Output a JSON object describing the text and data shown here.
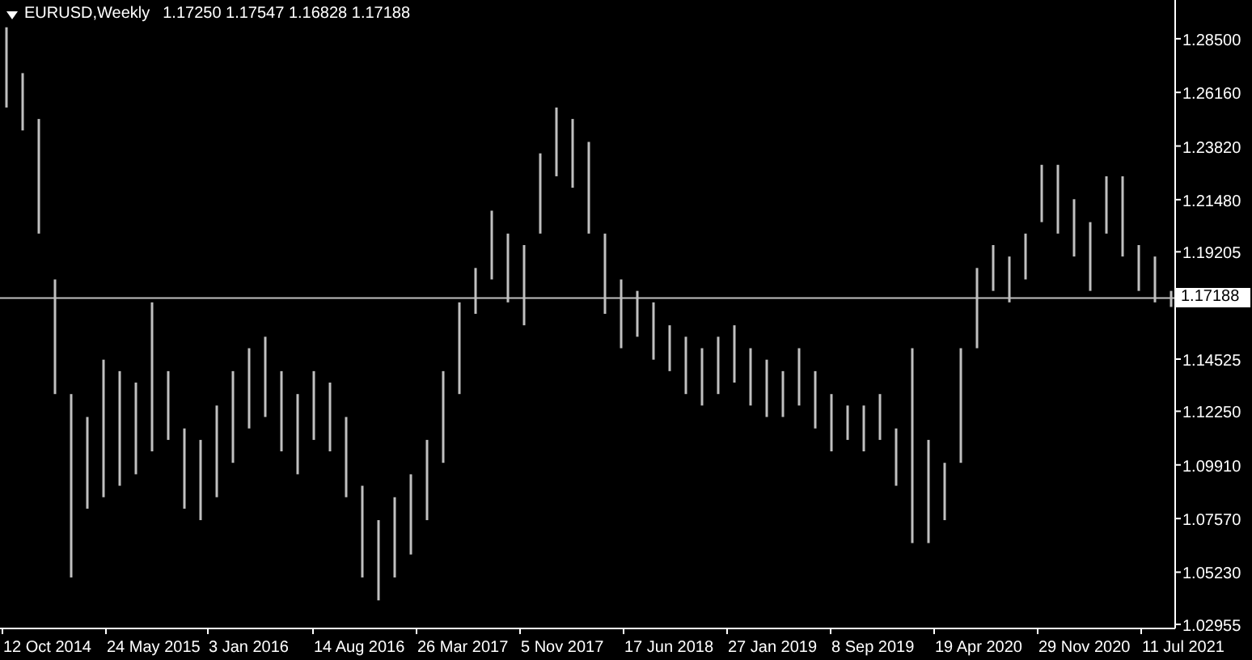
{
  "header": {
    "symbol_timeframe": "EURUSD,Weekly",
    "ohlc": "1.17250 1.17547 1.16828 1.17188"
  },
  "price_axis": {
    "labels": [
      "1.28500",
      "1.26160",
      "1.23820",
      "1.21480",
      "1.19205",
      "1.14525",
      "1.12250",
      "1.09910",
      "1.07570",
      "1.05230",
      "1.02955"
    ]
  },
  "time_axis": {
    "labels": [
      "12 Oct 2014",
      "24 May 2015",
      "3 Jan 2016",
      "14 Aug 2016",
      "26 Mar 2017",
      "5 Nov 2017",
      "17 Jun 2018",
      "27 Jan 2019",
      "8 Sep 2019",
      "19 Apr 2020",
      "29 Nov 2020",
      "11 Jul 2021"
    ]
  },
  "current_price": {
    "label": "1.17188"
  }
}
